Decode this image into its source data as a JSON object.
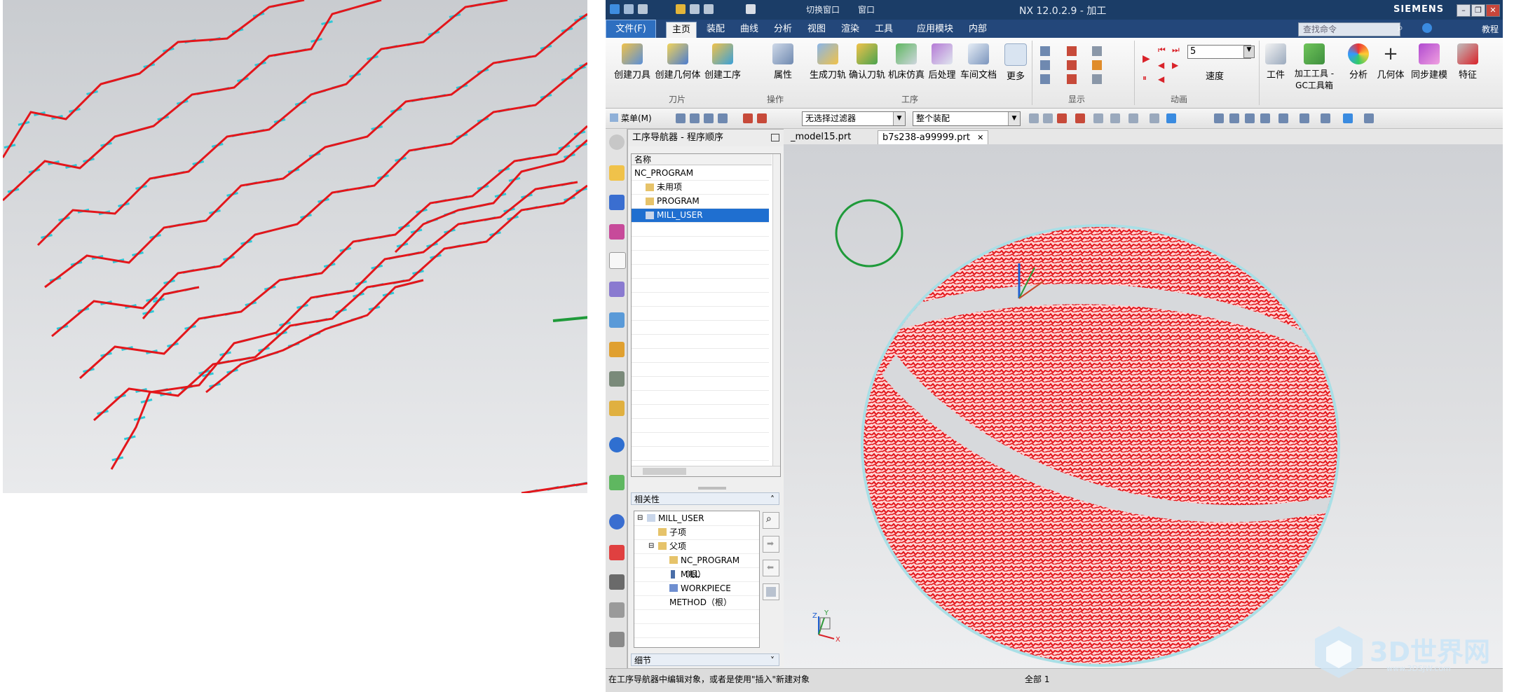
{
  "window": {
    "title": "NX 12.0.2.9 - 加工",
    "brand": "SIEMENS",
    "quick_access": [
      "切换窗口",
      "窗口"
    ]
  },
  "menubar": {
    "file_label": "文件(F)",
    "tabs": [
      "主页",
      "装配",
      "曲线",
      "分析",
      "视图",
      "渲染",
      "工具",
      "应用模块",
      "内部"
    ],
    "search_placeholder": "查找命令",
    "help_label": "教程"
  },
  "ribbon": {
    "buttons": [
      {
        "label": "创建刀具"
      },
      {
        "label": "创建几何体"
      },
      {
        "label": "创建工序"
      },
      {
        "label": "属性"
      },
      {
        "label": "生成刀轨"
      },
      {
        "label": "确认刀轨"
      },
      {
        "label": "机床仿真"
      },
      {
        "label": "后处理"
      },
      {
        "label": "车间文档"
      },
      {
        "label": "更多"
      }
    ],
    "groups": [
      "刀片",
      "操作",
      "工序",
      "显示",
      "动画"
    ],
    "speed_value": "5",
    "speed_label": "速度",
    "right_buttons": [
      "工件",
      "加工工具 -",
      "GC工具箱",
      "分析",
      "几何体",
      "同步建模",
      "特征"
    ]
  },
  "toolbar2": {
    "menu_label": "菜单(M)",
    "filter_value": "无选择过滤器",
    "scope_value": "整个装配"
  },
  "navigator": {
    "title": "工序导航器 - 程序顺序",
    "column_name": "名称",
    "tree": [
      {
        "label": "NC_PROGRAM",
        "selected": false
      },
      {
        "label": "未用项",
        "selected": false
      },
      {
        "label": "PROGRAM",
        "selected": false
      },
      {
        "label": "MILL_USER",
        "selected": true
      }
    ],
    "dependencies_title": "相关性",
    "dep_tree": [
      {
        "label": "MILL_USER"
      },
      {
        "label": "子项"
      },
      {
        "label": "父项"
      },
      {
        "label": "NC_PROGRAM（根）"
      },
      {
        "label": "MILL"
      },
      {
        "label": "WORKPIECE"
      },
      {
        "label": "METHOD（根）"
      }
    ],
    "details_title": "细节"
  },
  "file_tabs": [
    {
      "label": "_model15.prt",
      "active": false
    },
    {
      "label": "b7s238-a99999.prt",
      "active": true
    }
  ],
  "triad": {
    "x": "X",
    "y": "Y",
    "z": "Z"
  },
  "statusbar": {
    "message": "在工序导航器中编辑对象，或者是使用\"插入\"新建对象",
    "filter": "全部 1"
  },
  "watermark": {
    "text": "3D世界网",
    "url": "www.3DSJW.com"
  },
  "colors": {
    "toolpath": "#e3161b",
    "points": "#2ec7d6",
    "callout": "#1f9a3a",
    "selection": "#1f6fd0",
    "menubar": "#23477a"
  }
}
